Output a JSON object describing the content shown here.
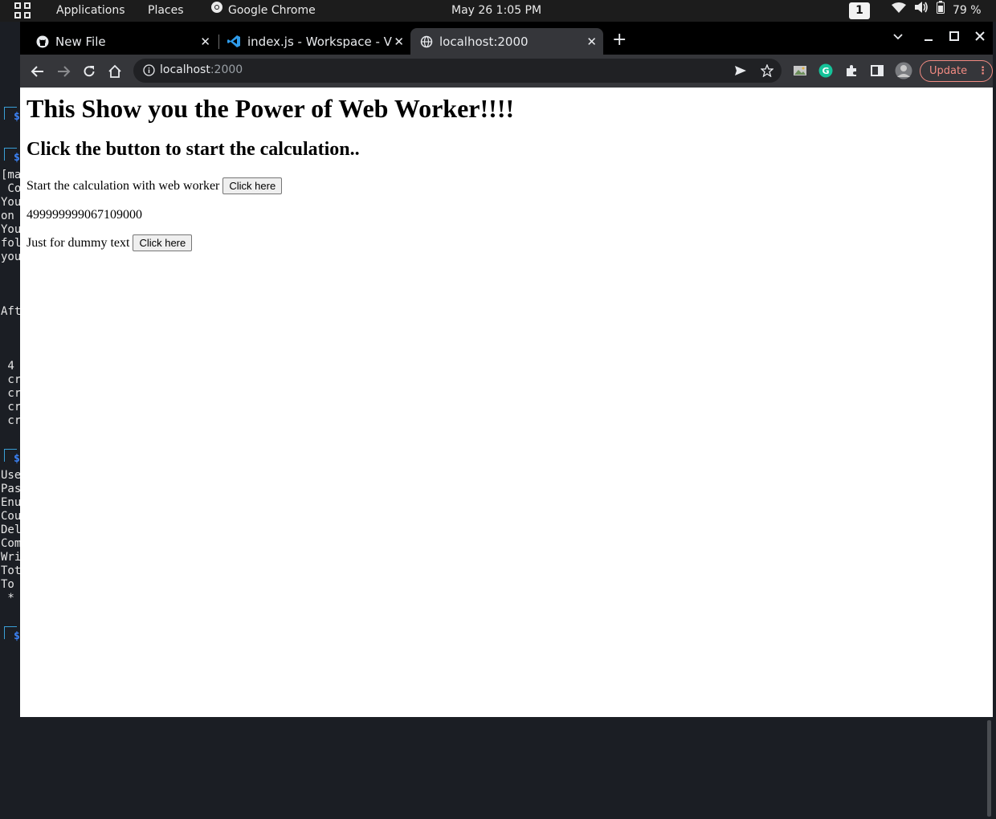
{
  "topbar": {
    "applications": "Applications",
    "places": "Places",
    "active_app": "Google Chrome",
    "clock": "May 26  1:05 PM",
    "workspace": "1",
    "battery": "79 %"
  },
  "terminal": {
    "lines": [
      "[ma",
      " Co",
      "You",
      "on ",
      "You",
      "fol",
      "you",
      "Aft",
      " 4",
      " cr",
      " cr",
      " cr",
      " cr",
      "Use",
      "Pas",
      "Enu",
      "Cou",
      "Del",
      "Com",
      "Wri",
      "Tot",
      "To ",
      " *"
    ],
    "prompt": "$"
  },
  "tabs": [
    {
      "label": "New File",
      "icon": "github-icon"
    },
    {
      "label": "index.js - Workspace - Visual Studio Code",
      "icon": "vscode-icon"
    },
    {
      "label": "localhost:2000",
      "icon": "globe-icon"
    }
  ],
  "omnibox": {
    "host": "localhost",
    "port": ":2000"
  },
  "update_label": "Update",
  "page": {
    "heading": "This Show you the Power of Web Worker!!!!",
    "subheading": "Click the button to start the calculation..",
    "row1_text": "Start the calculation with web worker",
    "row1_button": "Click here",
    "result": "499999999067109000",
    "row2_text": "Just for dummy text",
    "row2_button": "Click here"
  },
  "colors": {
    "accent_update": "#f28b82",
    "tab_active": "#35363a",
    "terminal_bg": "#1b1e24"
  }
}
